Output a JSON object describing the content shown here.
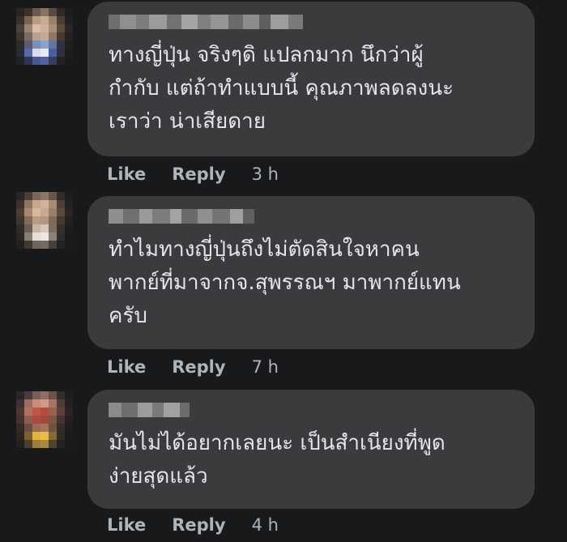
{
  "comments": [
    {
      "text": "ทางญี่ปุ่น จริงๆดิ แปลกมาก นึกว่าผู้\nกำกับ แต่ถ้าทำแบบนี้ คุณภาพลดลงนะ\nเราว่า น่าเสียดาย",
      "like_label": "Like",
      "reply_label": "Reply",
      "time": "3 h"
    },
    {
      "text": "ทำไมทางญี่ปุ่นถึงไม่ตัดสินใจหาคน\nพากย์ที่มาจากจ.สุพรรณฯ มาพากย์แทน\nครับ",
      "like_label": "Like",
      "reply_label": "Reply",
      "time": "7 h"
    },
    {
      "text": "มันไม่ได้อยากเลยนะ เป็นสำเนียงที่พูด\nง่ายสุดแล้ว",
      "like_label": "Like",
      "reply_label": "Reply",
      "time": "4 h"
    }
  ]
}
